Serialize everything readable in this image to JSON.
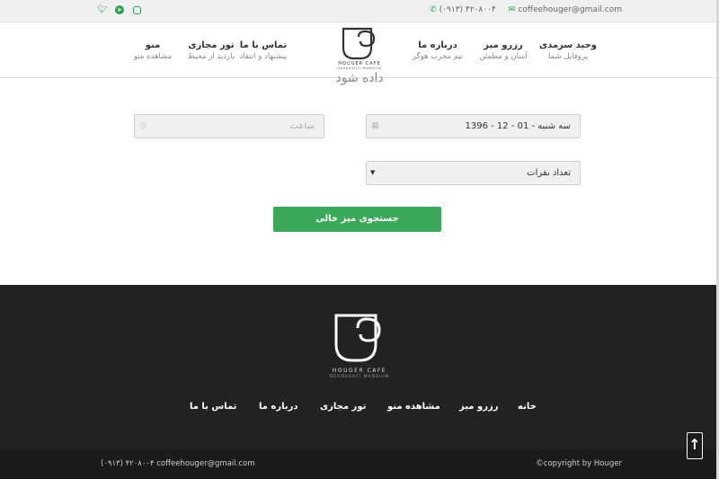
{
  "topbar": {
    "email": "coffeehouger@gmail.com",
    "phone": "(۰۹۱۳) ۴۲۰۸۰۰۴",
    "social": [
      "twitter-icon",
      "telegram-icon",
      "instagram-icon"
    ]
  },
  "header": {
    "nav": [
      {
        "title": "وحید سرمدی",
        "subtitle": "پروفایل شما"
      },
      {
        "title": "رزرو میز",
        "subtitle": "آسان و مطمئن"
      },
      {
        "title": "درباره ما",
        "subtitle": "تیم مجرب هوگر"
      },
      {
        "title": "تماس با ما",
        "subtitle": "پیشنهاد و انتقاد"
      },
      {
        "title": "تور مجازی",
        "subtitle": "بازدید از محیط"
      },
      {
        "title": "منو",
        "subtitle": "مشاهده منو"
      }
    ],
    "logo_line1": "HOUGER CAFE",
    "logo_line2": "DEHDASHTI MANSION"
  },
  "form": {
    "intro_line2": "داده شود",
    "date_value": "1396 - 12 - 01 - سه شنبه",
    "time_placeholder": "ساعت",
    "people_value": "تعداد نفرات",
    "search_label": "جستجوی میز خالی"
  },
  "footer": {
    "logo_line1": "HOUGER CAFE",
    "logo_line2": "DEHDASHTI MANSION",
    "nav": [
      "خانه",
      "رزرو میز",
      "مشاهده منو",
      "تور مجازی",
      "درباره ما",
      "تماس با ما"
    ],
    "contact": "(۰۹۱۳) ۴۲۰۸۰۰۴   coffeehouger@gmail.com",
    "copyright": "©copyright by Houger"
  },
  "colors": {
    "accent": "#3ca85a",
    "footer": "#222222",
    "bottom": "#1b1b1b"
  }
}
